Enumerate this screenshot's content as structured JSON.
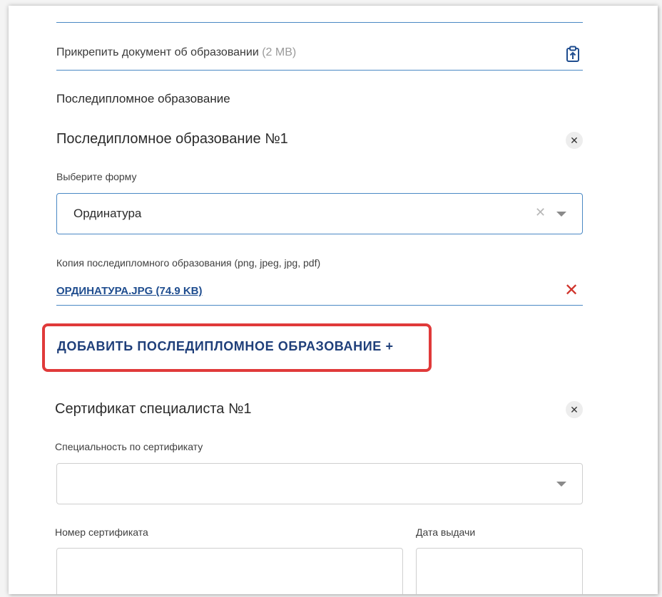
{
  "education": {
    "attach_label": "Прикрепить документ об образовании",
    "attach_size": "(2 MB)",
    "attach_icon": "clipboard-upload-icon"
  },
  "postgrad": {
    "section_title": "Последипломное образование",
    "entry_title": "Последипломное образование №1",
    "form_label": "Выберите форму",
    "form_value": "Ординатура",
    "copy_label": "Копия последипломного образования (png, jpeg, jpg, pdf)",
    "file_name": "ОРДИНАТУРА.JPG (74.9 KB)",
    "add_button": "ДОБАВИТЬ ПОСЛЕДИПЛОМНОЕ ОБРАЗОВАНИЕ +"
  },
  "certificate": {
    "entry_title": "Сертификат специалиста №1",
    "specialty_label": "Специальность по сертификату",
    "specialty_value": "",
    "number_label": "Номер сертификата",
    "number_value": "",
    "date_label": "Дата выдачи",
    "date_value": ""
  },
  "colors": {
    "accent": "#4a88c4",
    "link": "#1f4d8f",
    "remove": "#d0342c",
    "highlight": "#e03a3a"
  }
}
